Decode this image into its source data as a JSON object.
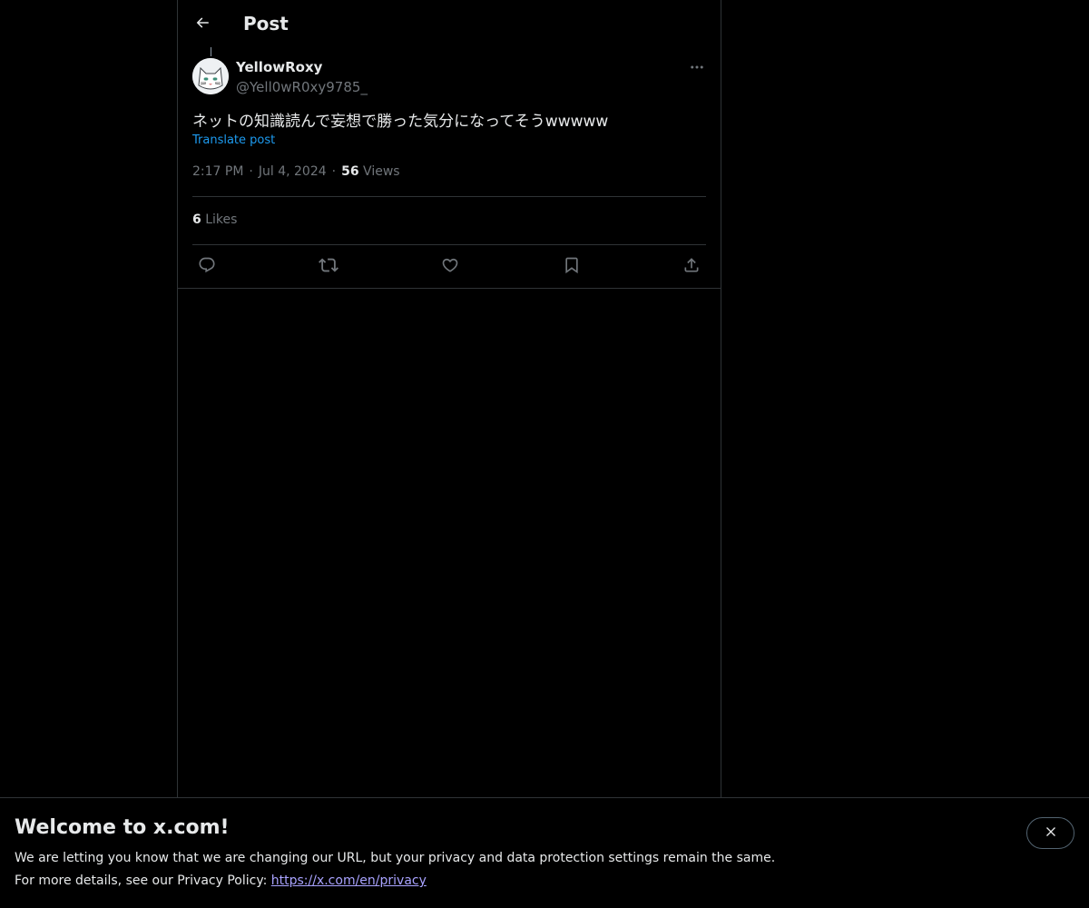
{
  "header": {
    "title": "Post",
    "back_icon": "arrow-left-icon"
  },
  "post": {
    "author": {
      "name": "YellowRoxy",
      "handle": "@Yell0wR0xy9785_",
      "avatar_icon": "cat-face-avatar"
    },
    "text": "ネットの知識読んで妄想で勝った気分になってそうwwwww",
    "translate_label": "Translate post",
    "time": "2:17 PM",
    "date": "Jul 4, 2024",
    "separator": "·",
    "views_count": "56",
    "views_label": "Views",
    "likes_count": "6",
    "likes_label": "Likes",
    "actions": [
      "reply-icon",
      "repost-icon",
      "like-icon",
      "bookmark-icon",
      "share-icon"
    ]
  },
  "banner": {
    "title": "Welcome to x.com!",
    "line1": "We are letting you know that we are changing our URL, but your privacy and data protection settings remain the same.",
    "line2_prefix": "For more details, see our Privacy Policy: ",
    "link": "https://x.com/en/privacy",
    "close_icon": "close-icon"
  },
  "colors": {
    "background": "#000000",
    "text_primary": "#e7e9ea",
    "text_secondary": "#71767b",
    "link_blue": "#1d9bf0",
    "border": "#2f3336",
    "privacy_link": "#a9a3ff"
  }
}
